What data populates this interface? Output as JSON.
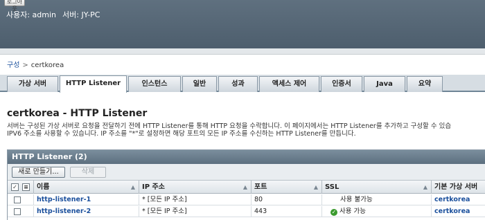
{
  "header": {
    "top_button_label": "로그아웃",
    "user_label": "사용자: admin",
    "server_label": "서버: JY-PC"
  },
  "breadcrumb": {
    "root": "구성",
    "separator": ">",
    "current": "certkorea"
  },
  "tabs": [
    {
      "label": "가상 서버",
      "active": false
    },
    {
      "label": "HTTP Listener",
      "active": true
    },
    {
      "label": "인스턴스",
      "active": false
    },
    {
      "label": "일반",
      "active": false
    },
    {
      "label": "성과",
      "active": false
    },
    {
      "label": "액세스 제어",
      "active": false
    },
    {
      "label": "인증서",
      "active": false
    },
    {
      "label": "Java",
      "active": false
    },
    {
      "label": "요약",
      "active": false
    }
  ],
  "page": {
    "title": "certkorea - HTTP Listener",
    "description_line1": "서버는 구성된 가상 서버로 요청을 전달하기 전에 HTTP Listener를 통해 HTTP 요청을 수락합니다. 이 페이지에서는 HTTP Listener를 추가하고 구성할 수 있습",
    "description_line2": "IPV6 주소를 사용할 수 있습니다. IP 주소를 \"*\"로 설정하면 해당 포트의 모든 IP 주소를 수신하는 HTTP Listener를 만듭니다."
  },
  "table": {
    "title": "HTTP Listener (2)",
    "new_button": "새로 만들기...",
    "delete_button": "삭제",
    "columns": [
      "이름",
      "IP 주소",
      "포트",
      "SSL",
      "기본 가상 서버"
    ],
    "rows": [
      {
        "name": "http-listener-1",
        "ip": "* [모든 IP 주소]",
        "port": "80",
        "ssl": "사용 불가능",
        "ssl_enabled": false,
        "virtual_server": "certkorea"
      },
      {
        "name": "http-listener-2",
        "ip": "* [모든 IP 주소]",
        "port": "443",
        "ssl": "사용 가능",
        "ssl_enabled": true,
        "virtual_server": "certkorea"
      }
    ]
  },
  "colors": {
    "header_bg": "#566776",
    "link": "#1a4f9c",
    "ssl_ok": "#3a9a2e"
  }
}
